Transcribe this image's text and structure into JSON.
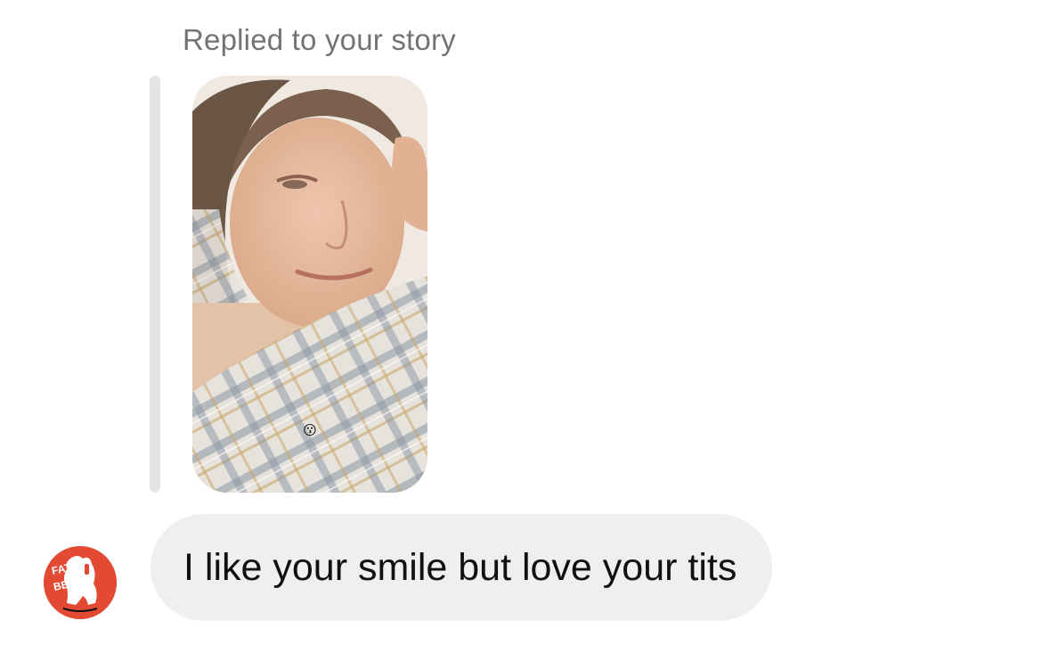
{
  "message": {
    "reply_context": "Replied to your story",
    "text": "I like your smile but love your tits"
  },
  "story": {
    "emoji_sticker": "😗"
  },
  "sender": {
    "avatar_logo_text": [
      "FAT",
      "BEAR"
    ]
  },
  "colors": {
    "bubble_background": "#efefef",
    "reply_context_text": "#737373",
    "reply_bar": "#e4e4e4",
    "avatar_background": "#e34a33"
  }
}
